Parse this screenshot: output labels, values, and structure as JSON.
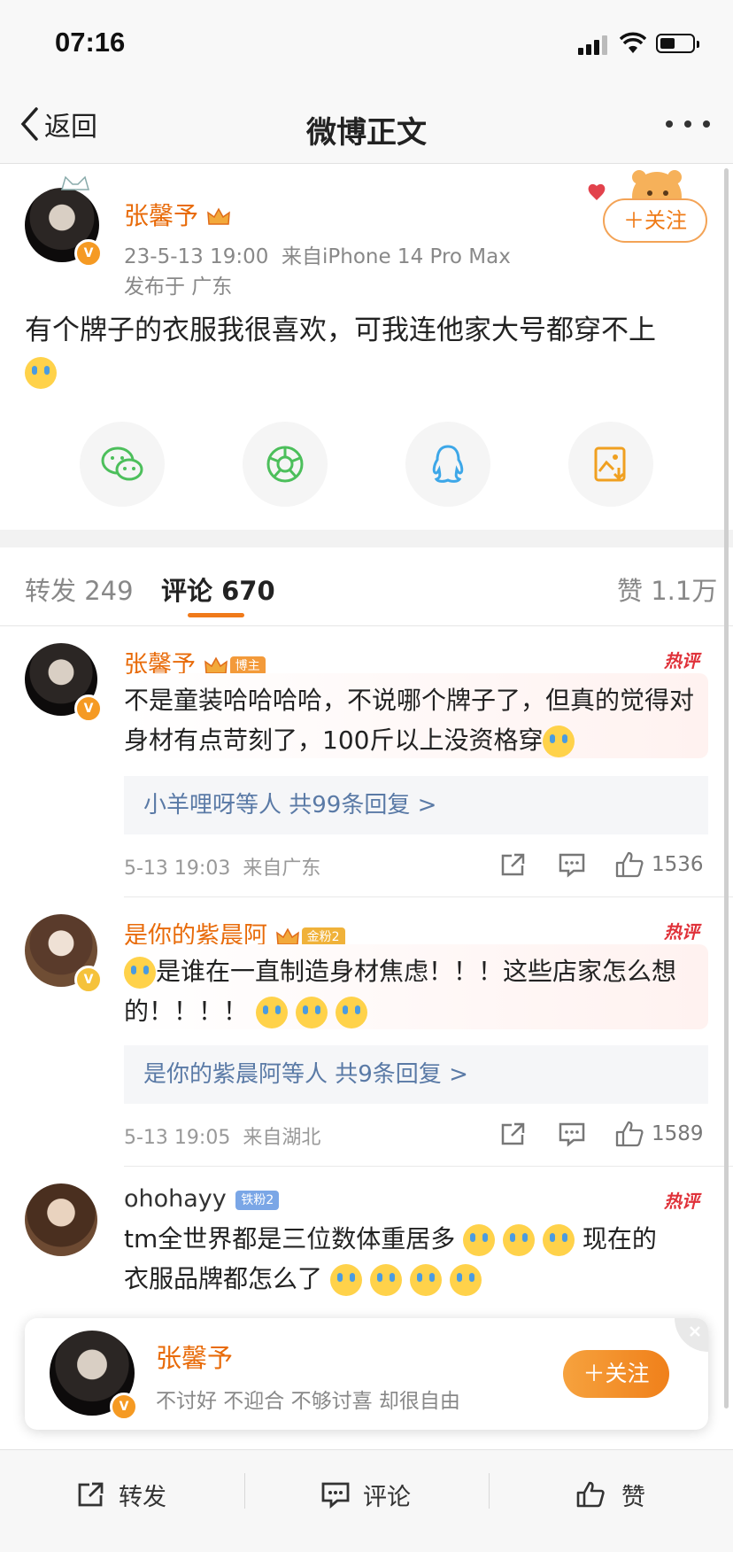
{
  "status_bar": {
    "time": "07:16"
  },
  "nav": {
    "back_label": "返回",
    "title": "微博正文"
  },
  "post": {
    "author": "张馨予",
    "datetime": "23-5-13 19:00",
    "source": "来自iPhone 14 Pro Max",
    "location": "发布于 广东",
    "follow_label": "＋关注",
    "text": "有个牌子的衣服我很喜欢，可我连他家大号都穿不上"
  },
  "share_icons": [
    "wechat-icon",
    "moments-icon",
    "qq-icon",
    "save-image-icon"
  ],
  "tabs": [
    {
      "label": "转发",
      "count": "249"
    },
    {
      "label": "评论",
      "count": "670"
    },
    {
      "label": "赞",
      "count": "1.1万"
    }
  ],
  "comments": [
    {
      "name": "张馨予",
      "tag": "博主",
      "hot": "热评",
      "text": "不是童装哈哈哈哈，不说哪个牌子了，但真的觉得对身材有点苛刻了，100斤以上没资格穿",
      "reply_summary": "小羊哩呀等人  共99条回复 >",
      "time": "5-13 19:03",
      "location": "来自广东",
      "likes": "1536"
    },
    {
      "name": "是你的紫晨阿",
      "tag": "金粉2",
      "hot": "热评",
      "text": "是谁在一直制造身材焦虑！！！这些店家怎么想的！！！！",
      "reply_summary": "是你的紫晨阿等人  共9条回复 >",
      "time": "5-13 19:05",
      "location": "来自湖北",
      "likes": "1589"
    },
    {
      "name": "ohohayy",
      "tag": "铁粉2",
      "hot": "热评",
      "text_a": "tm全世界都是三位数体重居多",
      "text_b": "现在的",
      "text_c": "衣服品牌都怎么了"
    }
  ],
  "popup": {
    "name": "张馨予",
    "bio": "不讨好 不迎合 不够讨喜 却很自由",
    "follow_label": "＋关注"
  },
  "bottom_bar": {
    "repost": "转发",
    "comment": "评论",
    "like": "赞"
  },
  "colors": {
    "accent": "#f07a1a",
    "username": "#e86b0a",
    "reply_link": "#5a7aa6",
    "hot": "#e0323a"
  }
}
